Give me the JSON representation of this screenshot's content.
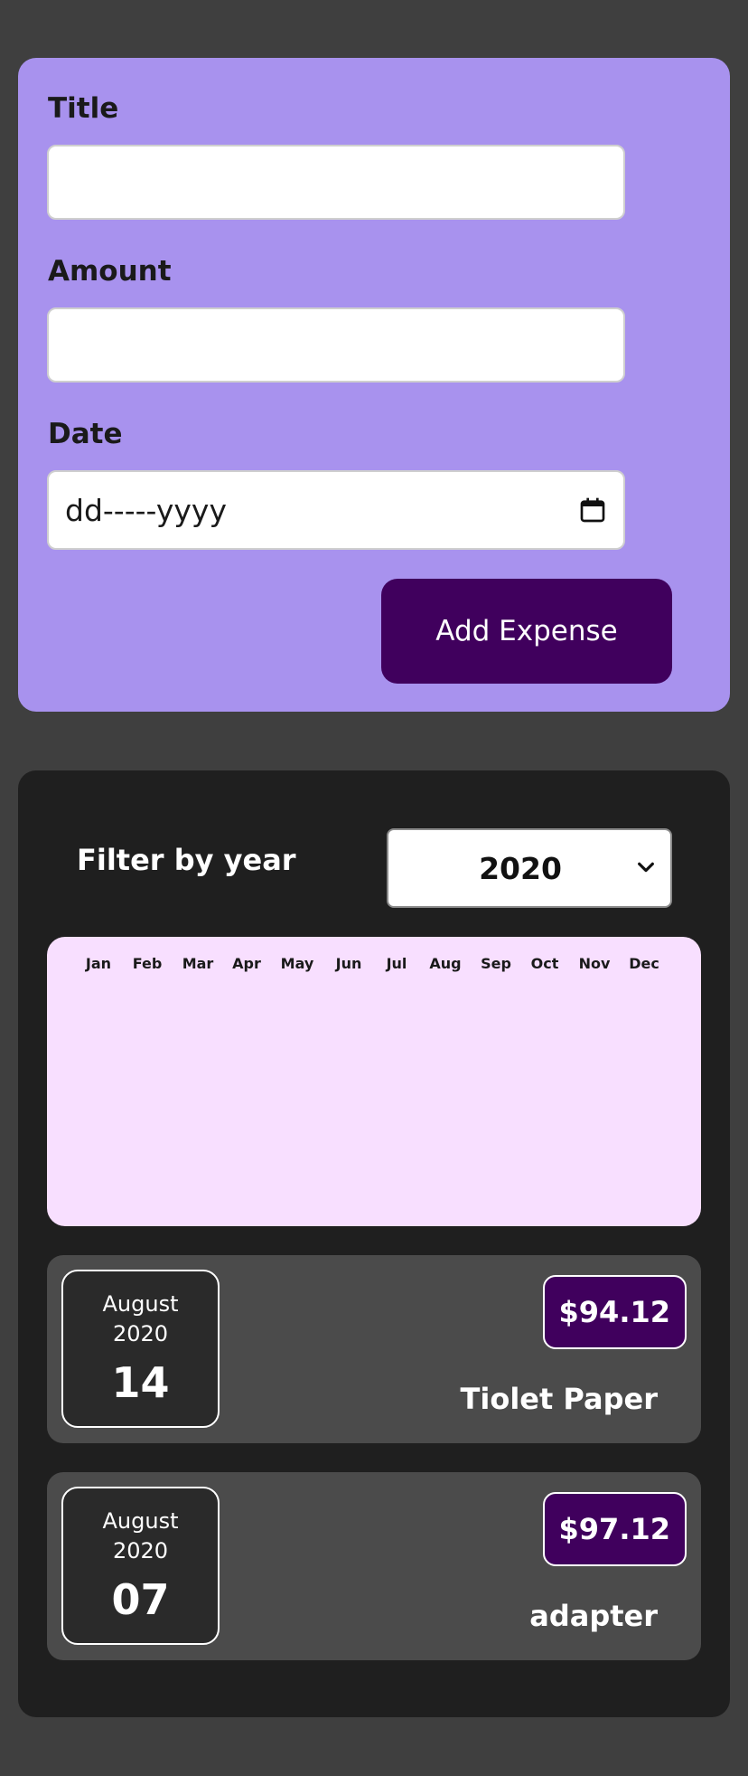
{
  "form": {
    "title_label": "Title",
    "title_value": "",
    "amount_label": "Amount",
    "amount_value": "",
    "date_label": "Date",
    "date_placeholder": "dd-----yyyy",
    "submit_label": "Add Expense",
    "accent_color": "#40005d",
    "background_color": "#a892ee"
  },
  "filter": {
    "label": "Filter by year",
    "selected_year": "2020"
  },
  "chart": {
    "months": [
      "Jan",
      "Feb",
      "Mar",
      "Apr",
      "May",
      "Jun",
      "Jul",
      "Aug",
      "Sep",
      "Oct",
      "Nov",
      "Dec"
    ]
  },
  "expenses": [
    {
      "month": "August",
      "year": "2020",
      "day": "14",
      "amount": "$94.12",
      "title": "Tiolet Paper"
    },
    {
      "month": "August",
      "year": "2020",
      "day": "07",
      "amount": "$97.12",
      "title": "adapter"
    }
  ],
  "icons": {
    "date_picker": "calendar-icon",
    "select": "chevron-down-icon"
  }
}
